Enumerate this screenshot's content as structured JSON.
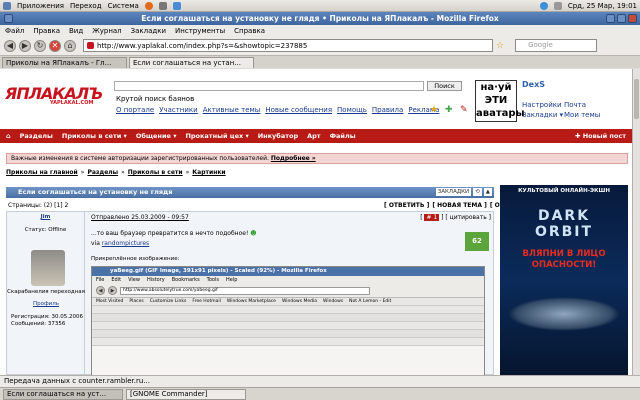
{
  "gnome_panel": {
    "menus": [
      "Приложения",
      "Переход",
      "Система"
    ],
    "datetime": "Срд, 25 Мар, 19:01"
  },
  "window": {
    "title": "Если соглашаться на установку не глядя • Приколы на ЯПлакалъ - Mozilla Firefox"
  },
  "menubar": [
    "Файл",
    "Правка",
    "Вид",
    "Журнал",
    "Закладки",
    "Инструменты",
    "Справка"
  ],
  "navbar": {
    "url": "http://www.yaplakal.com/index.php?s=&showtopic=237885",
    "search_placeholder": "Google"
  },
  "tabs": [
    {
      "label": "Приколы на ЯПлакалъ - Гл...",
      "active": false
    },
    {
      "label": "Если соглашаться на устан...",
      "active": true
    }
  ],
  "site": {
    "logo": "ЯПЛАКАЛЪ",
    "logo_sub": "YAPLAKAL.COM",
    "search_button": "Поиск",
    "search_label": "Крутой поиск баянов",
    "links": [
      "О портале",
      "Участники",
      "Активные темы",
      "Новые сообщения",
      "Помощь",
      "Правила",
      "Реклама"
    ],
    "avatar_text": "на·уй ЭТИ аватары",
    "username": "DexS",
    "user_links": [
      "Настройки",
      "Почта",
      "Закладки ▾",
      "Мои темы"
    ]
  },
  "rednav": {
    "items": [
      "Разделы",
      "Приколы в сети ▾",
      "Общение ▾",
      "Прокатный цех ▾",
      "Инкубатор",
      "Арт",
      "Файлы"
    ],
    "new_post": "Новый пост"
  },
  "notice": {
    "text": "Важные изменения в системе авторизации зарегистрированных пользователей. ",
    "link": "Подробнее »"
  },
  "breadcrumbs": [
    "Приколы на главной",
    "Разделы",
    "Приколы в сети",
    "Картинки"
  ],
  "topic": {
    "title": "Если соглашаться на установку не глядя",
    "buttons": [
      "ЗАКЛАДКИ",
      "⟲",
      "▲"
    ],
    "pages": "Страницы: (2) [1] 2",
    "actions": [
      "[ ОТВЕТИТЬ ]",
      "[ НОВАЯ ТЕМА ]",
      "[ ОПРОС ]"
    ]
  },
  "post": {
    "author": "Jim",
    "status": "Статус: Offline",
    "rank": "Скарабанелия переходная",
    "profile": "Профиль",
    "registered": "Регистрация: 30.05.2006",
    "messages": "Сообщений: 37356",
    "date": "Отправлено 25.03.2009 - 09:57",
    "number": "# 1",
    "quote": "[ цитировать ]",
    "text": "...то ваш браузер превратится в нечто подобное!",
    "via": "via ",
    "via_link": "randompictures",
    "attach": "Прикреплённое изображение:",
    "rating": "62"
  },
  "inner_shot": {
    "title": "yaBeeg.gif (GIF Image, 391x91 pixels) - Scaled (92%) - Mozilla Firefox",
    "menu": [
      "File",
      "Edit",
      "View",
      "History",
      "Bookmarks",
      "Tools",
      "Help"
    ],
    "url": "http://www.absolutelytrue.com/yabeeg.gif",
    "bookmarks": [
      "Most Visited",
      "Places",
      "Customize Links",
      "Free Hotmail",
      "Windows Marketplace",
      "Windows Media",
      "Windows",
      "Not A Lemon - Edit"
    ]
  },
  "ad": {
    "top": "КУЛЬТОВЫЙ ОНЛАЙН-ЭКШН",
    "logo": "DARK ORBIT",
    "text": "ВЛЯПНИ В ЛИЦО ОПАСНОСТИ!"
  },
  "statusbar": {
    "text": "Передача данных с counter.rambler.ru..."
  },
  "taskbar": [
    {
      "label": "Если соглашаться на уст...",
      "active": true
    },
    {
      "label": "[GNOME Commander]",
      "active": false
    }
  ],
  "colors": {
    "red_nav": "#b81a16",
    "title_blue": "#496ea3",
    "ad_bg": "#0b2b5a"
  }
}
